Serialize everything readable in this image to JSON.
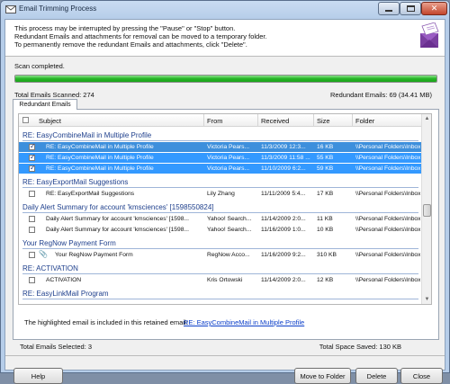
{
  "window": {
    "title": "Email Trimming Process"
  },
  "intro": {
    "line1": "This process may be interrupted by pressing the \"Pause\" or \"Stop\" button.",
    "line2": "Redundant Emails and attachments for removal can be moved to a temporary folder.",
    "line3": "To permanently remove the redundant Emails and attachments, click \"Delete\"."
  },
  "status": {
    "scan": "Scan completed.",
    "progress": 1.0,
    "total_scanned": "Total Emails Scanned:  274",
    "redundant": "Redundant Emails:  69 (34.41 MB)"
  },
  "tabs": [
    "Redundant Emails"
  ],
  "grid": {
    "columns": {
      "subject": "Subject",
      "from": "From",
      "received": "Received",
      "size": "Size",
      "folder": "Folder"
    },
    "groups": [
      {
        "title": "RE: EasyCombineMail in Multiple Profile",
        "rows": [
          {
            "checked": true,
            "selected": true,
            "subject": "RE: EasyCombineMail in Multiple Profile",
            "from": "Victoria Pears...",
            "received": "11/3/2009 12:3...",
            "size": "16 KB",
            "folder": "\\\\Personal Folders\\Inbox"
          },
          {
            "checked": true,
            "selected": true,
            "subject": "RE: EasyCombineMail in Multiple Profile",
            "from": "Victoria Pears...",
            "received": "11/3/2009 11:58 ...",
            "size": "55 KB",
            "folder": "\\\\Personal Folders\\Inbox"
          },
          {
            "checked": true,
            "selected": true,
            "subject": "RE: EasyCombineMail in Multiple Profile",
            "from": "Victoria Pears...",
            "received": "11/10/2009 6:2...",
            "size": "59 KB",
            "folder": "\\\\Personal Folders\\Inbox"
          }
        ]
      },
      {
        "title": "RE: EasyExportMail Suggestions",
        "rows": [
          {
            "checked": false,
            "selected": false,
            "subject": "RE: EasyExportMail Suggestions",
            "from": "Lily Zhang",
            "received": "11/11/2009 5:4...",
            "size": "17 KB",
            "folder": "\\\\Personal Folders\\Inbox"
          }
        ]
      },
      {
        "title": "Daily Alert Summary for account 'kmsciences' [1598550824]",
        "rows": [
          {
            "checked": false,
            "selected": false,
            "subject": "Daily Alert Summary for account 'kmsciences' [1598...",
            "from": "Yahoo! Search...",
            "received": "11/14/2009 2:0...",
            "size": "11 KB",
            "folder": "\\\\Personal Folders\\Inbox"
          },
          {
            "checked": false,
            "selected": false,
            "subject": "Daily Alert Summary for account 'kmsciences' [1598...",
            "from": "Yahoo! Search...",
            "received": "11/16/2009 1:0...",
            "size": "10 KB",
            "folder": "\\\\Personal Folders\\Inbox"
          }
        ]
      },
      {
        "title": "Your RegNow Payment Form",
        "rows": [
          {
            "checked": false,
            "selected": false,
            "attachment": true,
            "subject": "Your RegNow Payment Form",
            "from": "RegNow Acco...",
            "received": "11/16/2009 9:2...",
            "size": "310 KB",
            "folder": "\\\\Personal Folders\\Inbox"
          }
        ]
      },
      {
        "title": "RE: ACTIVATION",
        "rows": [
          {
            "checked": false,
            "selected": false,
            "subject": "ACTIVATION",
            "from": "Kris Ortowski",
            "received": "11/14/2009 2:0...",
            "size": "12 KB",
            "folder": "\\\\Personal Folders\\Inbox"
          }
        ]
      },
      {
        "title": "RE: EasyLinkMail Program",
        "rows": []
      }
    ]
  },
  "info": {
    "text": "The highlighted email is included in this retained email:",
    "link": "RE: EasyCombineMail in Multiple Profile"
  },
  "totals": {
    "selected": "Total Emails Selected:  3",
    "saved": "Total Space Saved:    130 KB"
  },
  "buttons": {
    "help": "Help",
    "move": "Move to Folder",
    "delete": "Delete",
    "close": "Close"
  }
}
